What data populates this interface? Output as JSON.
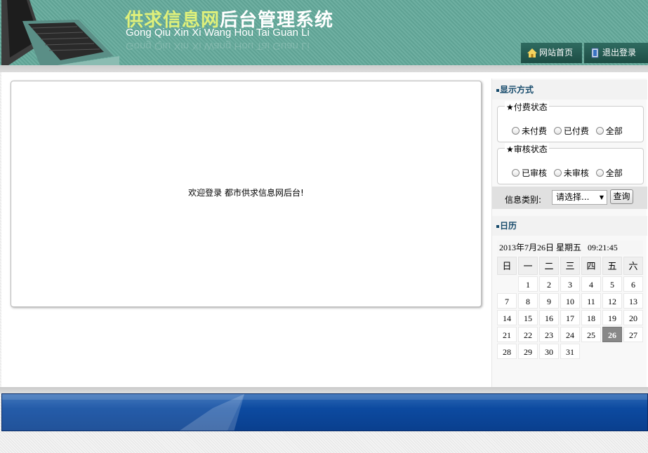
{
  "header": {
    "logo_part1": "供求",
    "logo_part2": "信息",
    "logo_part3": "网",
    "logo_part4": "后台管理系统",
    "logo_en": "Gong Qiu Xin Xi Wang Hou Tai Guan Li",
    "nav": [
      {
        "label": "网站首页",
        "icon": "home-icon"
      },
      {
        "label": "退出登录",
        "icon": "logout-icon"
      }
    ]
  },
  "main": {
    "welcome": "欢迎登录 都市供求信息网后台!"
  },
  "sidebar": {
    "display_title": "显示方式",
    "pay_group": {
      "legend": "★付费状态",
      "options": [
        "未付费",
        "已付费",
        "全部"
      ]
    },
    "audit_group": {
      "legend": "★审核状态",
      "options": [
        "已审核",
        "未审核",
        "全部"
      ]
    },
    "filter": {
      "label": "信息类别:",
      "selected": "请选择...",
      "query_label": "查询"
    },
    "calendar_title": "日历",
    "calendar": {
      "date": "2013年7月26日",
      "weekday": "星期五",
      "time": "09:21:45",
      "weekdays": [
        "日",
        "一",
        "二",
        "三",
        "四",
        "五",
        "六"
      ],
      "weeks": [
        [
          "",
          "1",
          "2",
          "3",
          "4",
          "5",
          "6"
        ],
        [
          "7",
          "8",
          "9",
          "10",
          "11",
          "12",
          "13"
        ],
        [
          "14",
          "15",
          "16",
          "17",
          "18",
          "19",
          "20"
        ],
        [
          "21",
          "22",
          "23",
          "24",
          "25",
          "26",
          "27"
        ],
        [
          "28",
          "29",
          "30",
          "31",
          "",
          "",
          ""
        ]
      ],
      "today": "26"
    }
  },
  "colors": {
    "header_teal": "#5fa294",
    "accent_navy": "#164a6b",
    "footer_blue": "#0c4aa0"
  }
}
